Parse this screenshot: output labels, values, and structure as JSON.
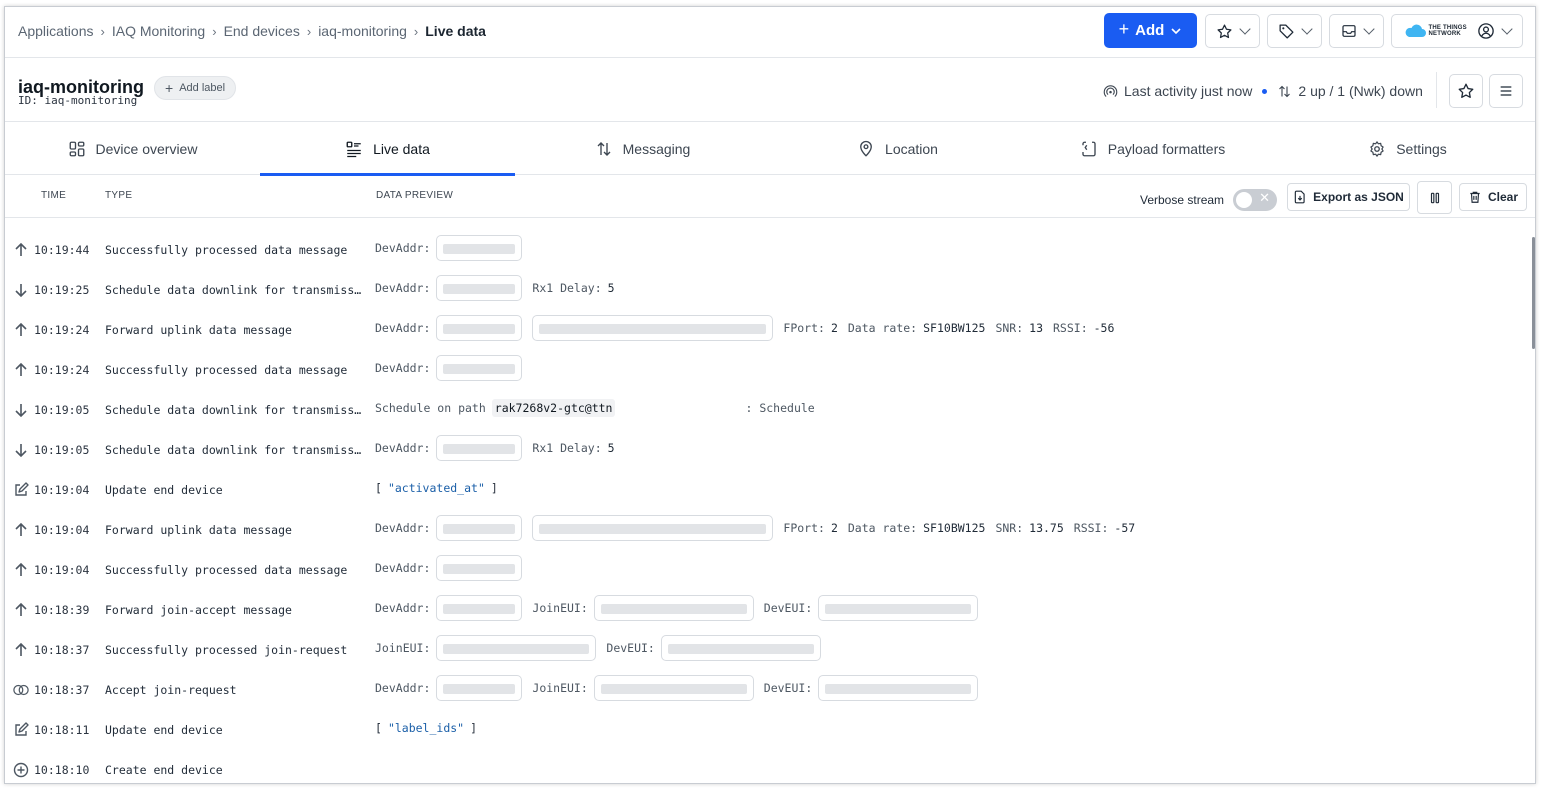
{
  "breadcrumb": {
    "items": [
      "Applications",
      "IAQ Monitoring",
      "End devices",
      "iaq-monitoring"
    ],
    "current": "Live data"
  },
  "topbar": {
    "add_label": "Add",
    "brand": "THE THINGS NETWORK",
    "accent": "#1a5cf2"
  },
  "device": {
    "name": "iaq-monitoring",
    "id_line": "ID: iaq-monitoring",
    "add_label": "Add label",
    "last_activity": "Last activity just now",
    "traffic": "2 up / 1 (Nwk) down"
  },
  "tabs": [
    {
      "label": "Device overview",
      "icon": "grid-icon"
    },
    {
      "label": "Live data",
      "icon": "list-icon"
    },
    {
      "label": "Messaging",
      "icon": "up-down-arrows-icon"
    },
    {
      "label": "Location",
      "icon": "map-pin-icon"
    },
    {
      "label": "Payload formatters",
      "icon": "code-file-icon"
    },
    {
      "label": "Settings",
      "icon": "gear-icon"
    }
  ],
  "columns": {
    "time": "TIME",
    "type": "TYPE",
    "preview": "DATA PREVIEW"
  },
  "controls": {
    "verbose_label": "Verbose stream",
    "verbose_on": false,
    "export_label": "Export as JSON",
    "clear_label": "Clear"
  },
  "events": [
    {
      "icon": "arrow-up-icon",
      "time": "10:19:44",
      "type": "Successfully processed data message",
      "preview": {
        "devaddr": "DevAddr:"
      }
    },
    {
      "icon": "arrow-down-icon",
      "time": "10:19:25",
      "type": "Schedule data downlink for transmission",
      "preview": {
        "devaddr": "DevAddr:",
        "rx1_label": "Rx1 Delay:",
        "rx1": "5"
      }
    },
    {
      "icon": "arrow-up-icon",
      "time": "10:19:24",
      "type": "Forward uplink data message",
      "preview": {
        "devaddr": "DevAddr:",
        "fport_label": "FPort:",
        "fport": "2",
        "dr_label": "Data rate:",
        "dr": "SF10BW125",
        "snr_label": "SNR:",
        "snr": "13",
        "rssi_label": "RSSI:",
        "rssi": "-56"
      }
    },
    {
      "icon": "arrow-up-icon",
      "time": "10:19:24",
      "type": "Successfully processed data message",
      "preview": {
        "devaddr": "DevAddr:"
      }
    },
    {
      "icon": "arrow-down-icon",
      "time": "10:19:05",
      "type": "Schedule data downlink for transmission",
      "preview": {
        "path_label": "Schedule on path",
        "path": "rak7268v2-gtc@ttn",
        "tail": ": Schedule"
      }
    },
    {
      "icon": "arrow-down-icon",
      "time": "10:19:05",
      "type": "Schedule data downlink for transmission",
      "preview": {
        "devaddr": "DevAddr:",
        "rx1_label": "Rx1 Delay:",
        "rx1": "5"
      }
    },
    {
      "icon": "edit-icon",
      "time": "10:19:04",
      "type": "Update end device",
      "preview": {
        "open": "[",
        "field": "\"activated_at\"",
        "close": "]"
      }
    },
    {
      "icon": "arrow-up-icon",
      "time": "10:19:04",
      "type": "Forward uplink data message",
      "preview": {
        "devaddr": "DevAddr:",
        "fport_label": "FPort:",
        "fport": "2",
        "dr_label": "Data rate:",
        "dr": "SF10BW125",
        "snr_label": "SNR:",
        "snr": "13.75",
        "rssi_label": "RSSI:",
        "rssi": "-57"
      }
    },
    {
      "icon": "arrow-up-icon",
      "time": "10:19:04",
      "type": "Successfully processed data message",
      "preview": {
        "devaddr": "DevAddr:"
      }
    },
    {
      "icon": "arrow-up-icon",
      "time": "10:18:39",
      "type": "Forward join-accept message",
      "preview": {
        "devaddr": "DevAddr:",
        "joineui": "JoinEUI:",
        "deveui": "DevEUI:"
      }
    },
    {
      "icon": "arrow-up-icon",
      "time": "10:18:37",
      "type": "Successfully processed join-request",
      "preview": {
        "joineui": "JoinEUI:",
        "deveui": "DevEUI:"
      }
    },
    {
      "icon": "join-rings-icon",
      "time": "10:18:37",
      "type": "Accept join-request",
      "preview": {
        "devaddr": "DevAddr:",
        "joineui": "JoinEUI:",
        "deveui": "DevEUI:"
      }
    },
    {
      "icon": "edit-icon",
      "time": "10:18:11",
      "type": "Update end device",
      "preview": {
        "open": "[",
        "field": "\"label_ids\"",
        "close": "]"
      }
    },
    {
      "icon": "plus-circle-icon",
      "time": "10:18:10",
      "type": "Create end device",
      "preview": {}
    }
  ]
}
